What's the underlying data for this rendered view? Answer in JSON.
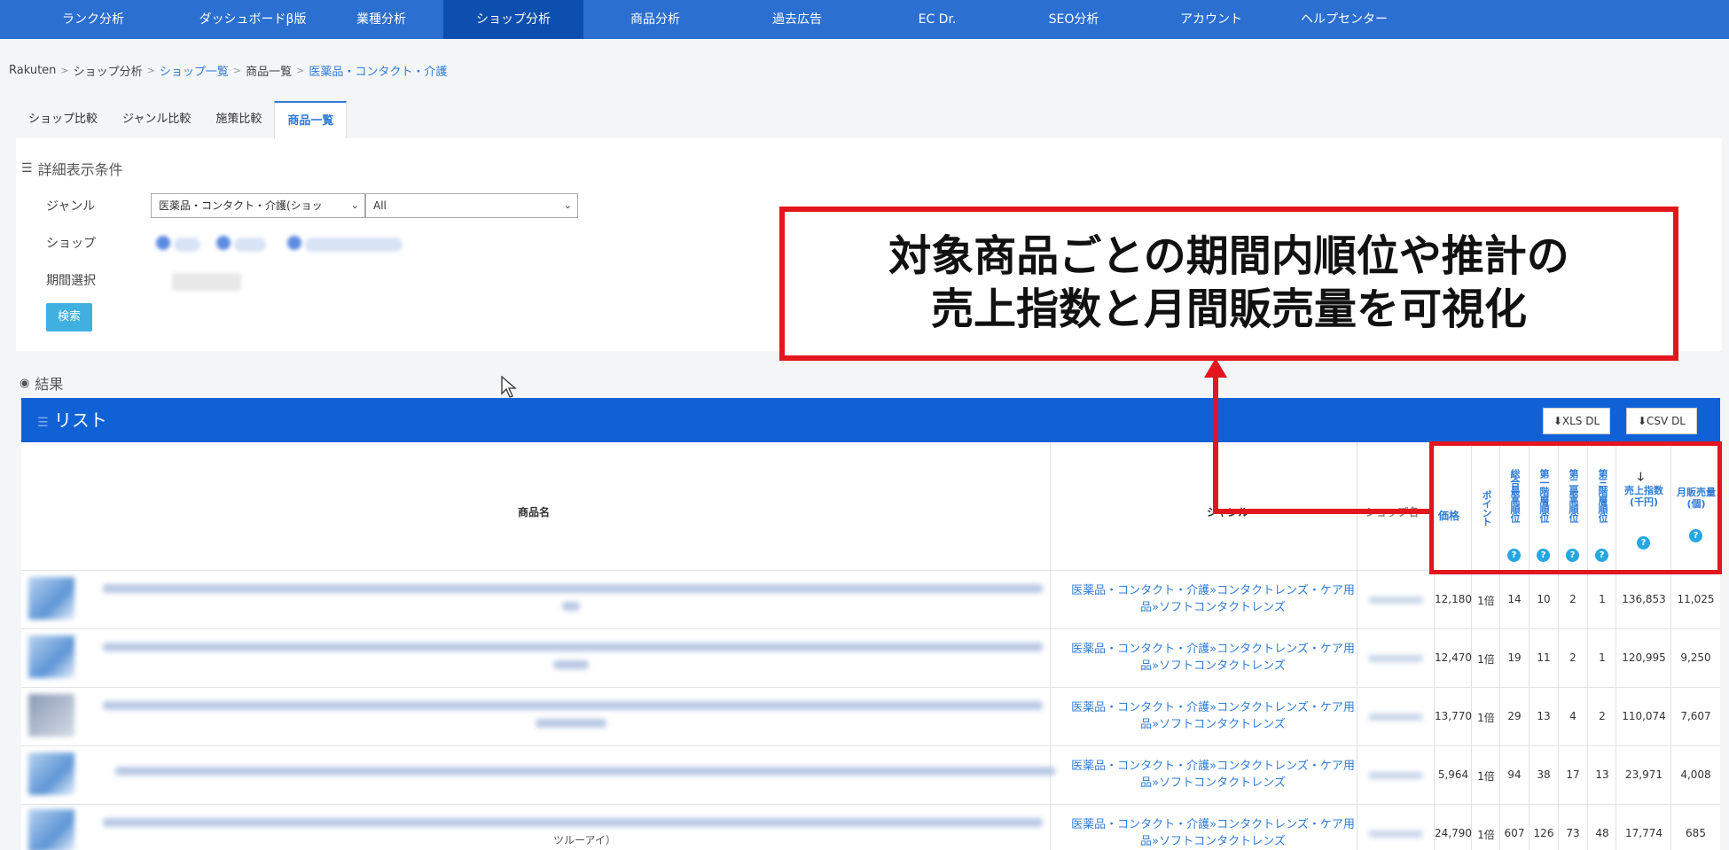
{
  "nav": {
    "items": [
      {
        "label": "ランク分析"
      },
      {
        "label": "ダッシュボードβ版"
      },
      {
        "label": "業種分析"
      },
      {
        "label": "ショップ分析",
        "active": true
      },
      {
        "label": "商品分析"
      },
      {
        "label": "過去広告"
      },
      {
        "label": "EC Dr."
      },
      {
        "label": "SEO分析"
      },
      {
        "label": "アカウント"
      },
      {
        "label": "ヘルプセンター"
      }
    ]
  },
  "breadcrumb": [
    "Rakuten",
    "ショップ分析",
    "ショップ一覧",
    "商品一覧",
    "医薬品・コンタクト・介護"
  ],
  "tabs": [
    "ショップ比較",
    "ジャンル比較",
    "施策比較",
    "商品一覧"
  ],
  "conditions": {
    "title": "詳細表示条件",
    "genre_label": "ジャンル",
    "genre_select": "医薬品・コンタクト・介護(ショッ",
    "genre_sub_select": "All",
    "shop_label": "ショップ",
    "period_label": "期間選択",
    "search_button": "検索"
  },
  "results": {
    "title": "結果",
    "list_title": "リスト",
    "xls_button": "XLS DL",
    "csv_button": "CSV DL"
  },
  "table": {
    "headers": {
      "product_name": "商品名",
      "genre": "ジャンル",
      "shop": "ショップ名",
      "price": "価格",
      "point": "ポイント",
      "rank_overall": "総合最高順位",
      "rank_1": "第一階層順位",
      "rank_2": "第二最高順位",
      "rank_3": "第三階層順位",
      "sales_index": "売上指数(千円)",
      "monthly_sales": "月販売量(個)"
    },
    "genre_text_line1": "医薬品・コンタクト・介護»コンタクトレンズ・ケア用",
    "genre_text_line2": "品»ソフトコンタクトレンズ",
    "row5_name_fragment": "ツルーアイ）",
    "rows": [
      {
        "price": "12,180",
        "point": "1倍",
        "r0": "14",
        "r1": "10",
        "r2": "2",
        "r3": "1",
        "sales": "136,853",
        "qty": "11,025"
      },
      {
        "price": "12,470",
        "point": "1倍",
        "r0": "19",
        "r1": "11",
        "r2": "2",
        "r3": "1",
        "sales": "120,995",
        "qty": "9,250"
      },
      {
        "price": "13,770",
        "point": "1倍",
        "r0": "29",
        "r1": "13",
        "r2": "4",
        "r3": "2",
        "sales": "110,074",
        "qty": "7,607"
      },
      {
        "price": "5,964",
        "point": "1倍",
        "r0": "94",
        "r1": "38",
        "r2": "17",
        "r3": "13",
        "sales": "23,971",
        "qty": "4,008"
      },
      {
        "price": "24,790",
        "point": "1倍",
        "r0": "607",
        "r1": "126",
        "r2": "73",
        "r3": "48",
        "sales": "17,774",
        "qty": "685"
      }
    ]
  },
  "annotation": {
    "line1": "対象商品ごとの期間内順位や推計の",
    "line2": "売上指数と月間販売量を可視化"
  },
  "colors": {
    "nav": "#2b6fd0",
    "list_bar": "#1161d6",
    "accent_red": "#e3161d"
  }
}
